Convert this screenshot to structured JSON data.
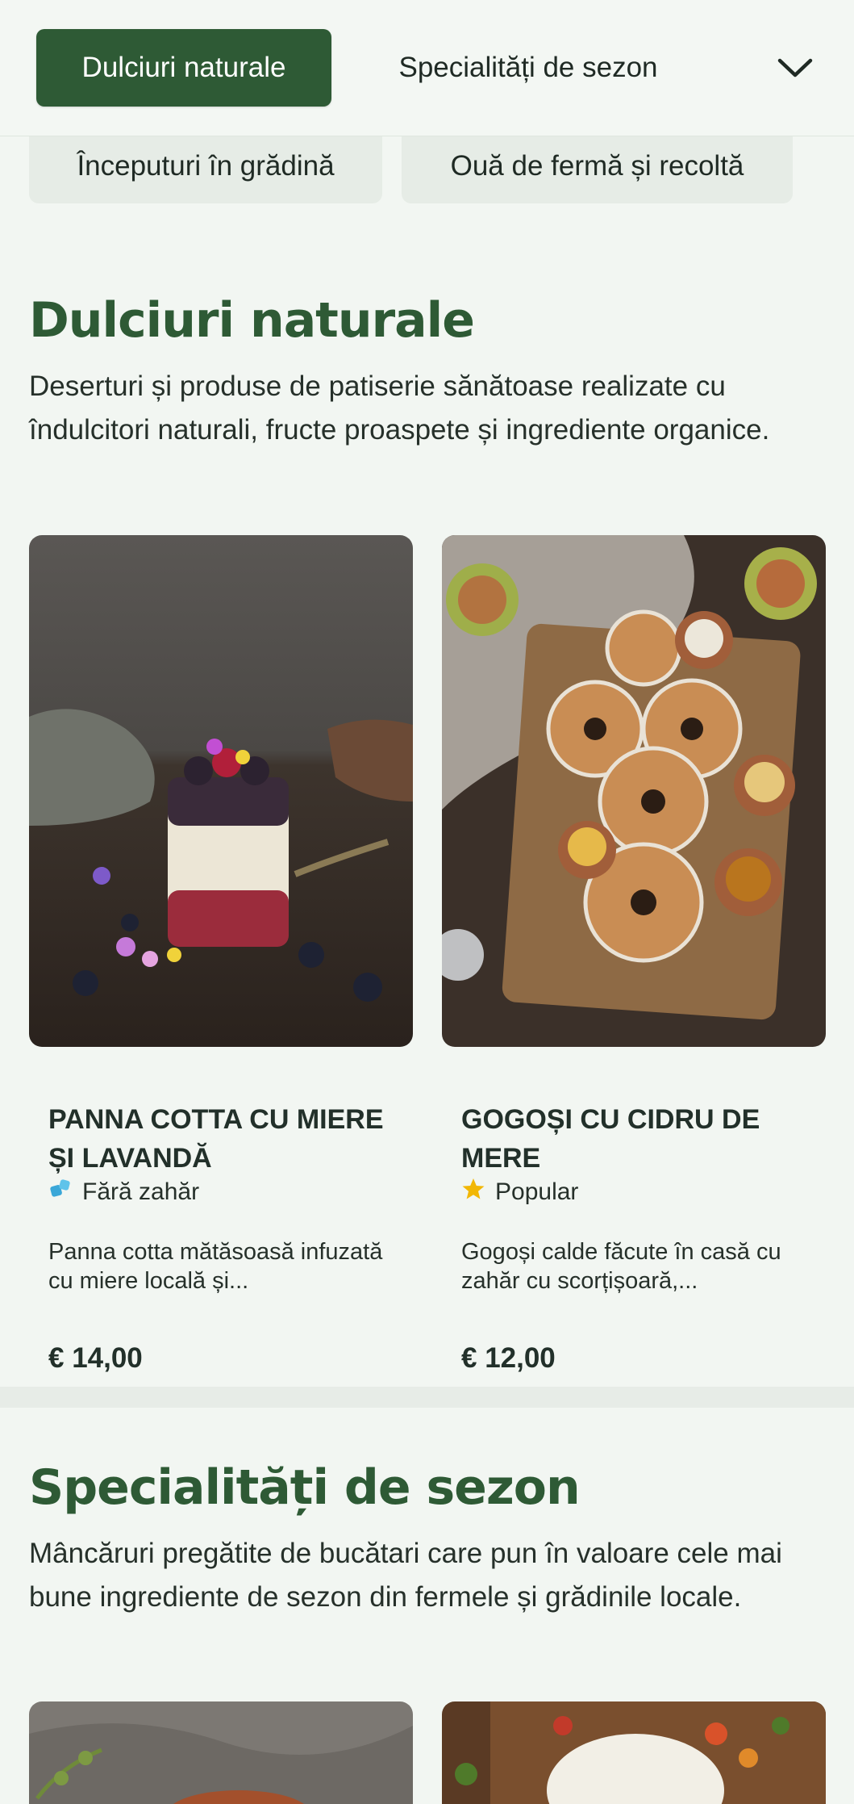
{
  "nav": {
    "active_tab": "Dulciuri naturale",
    "next_tab": "Specialități de sezon",
    "row2": [
      "Începuturi în grădină",
      "Ouă de fermă și recoltă"
    ],
    "expand_icon": "chevron-down-icon"
  },
  "sections": [
    {
      "title": "Dulciuri naturale",
      "description": "Deserturi și produse de patiserie sănătoase realizate cu îndulcitori naturali, fructe proaspete și ingrediente organice.",
      "items": [
        {
          "name": "PANNA COTTA CU MIERE ȘI LAVANDĂ",
          "badge": "Fără zahăr",
          "badge_icon": "sugar-free-icon",
          "description": "Panna cotta mătăsoasă infuzată cu miere locală și...",
          "price": "€ 14,00"
        },
        {
          "name": "GOGOȘI CU CIDRU DE MERE",
          "badge": "Popular",
          "badge_icon": "star-icon",
          "description": "Gogoși calde făcute în casă cu zahăr cu scorțișoară,...",
          "price": "€ 12,00"
        }
      ]
    },
    {
      "title": "Specialități de sezon",
      "description": "Mâncăruri pregătite de bucătari care pun în valoare cele mai bune ingrediente de sezon din fermele și grădinile locale."
    }
  ],
  "colors": {
    "brand_green": "#2e5a35",
    "background": "#f2f6f2",
    "star": "#f2b705",
    "sugar_free": "#3aa7d8"
  }
}
